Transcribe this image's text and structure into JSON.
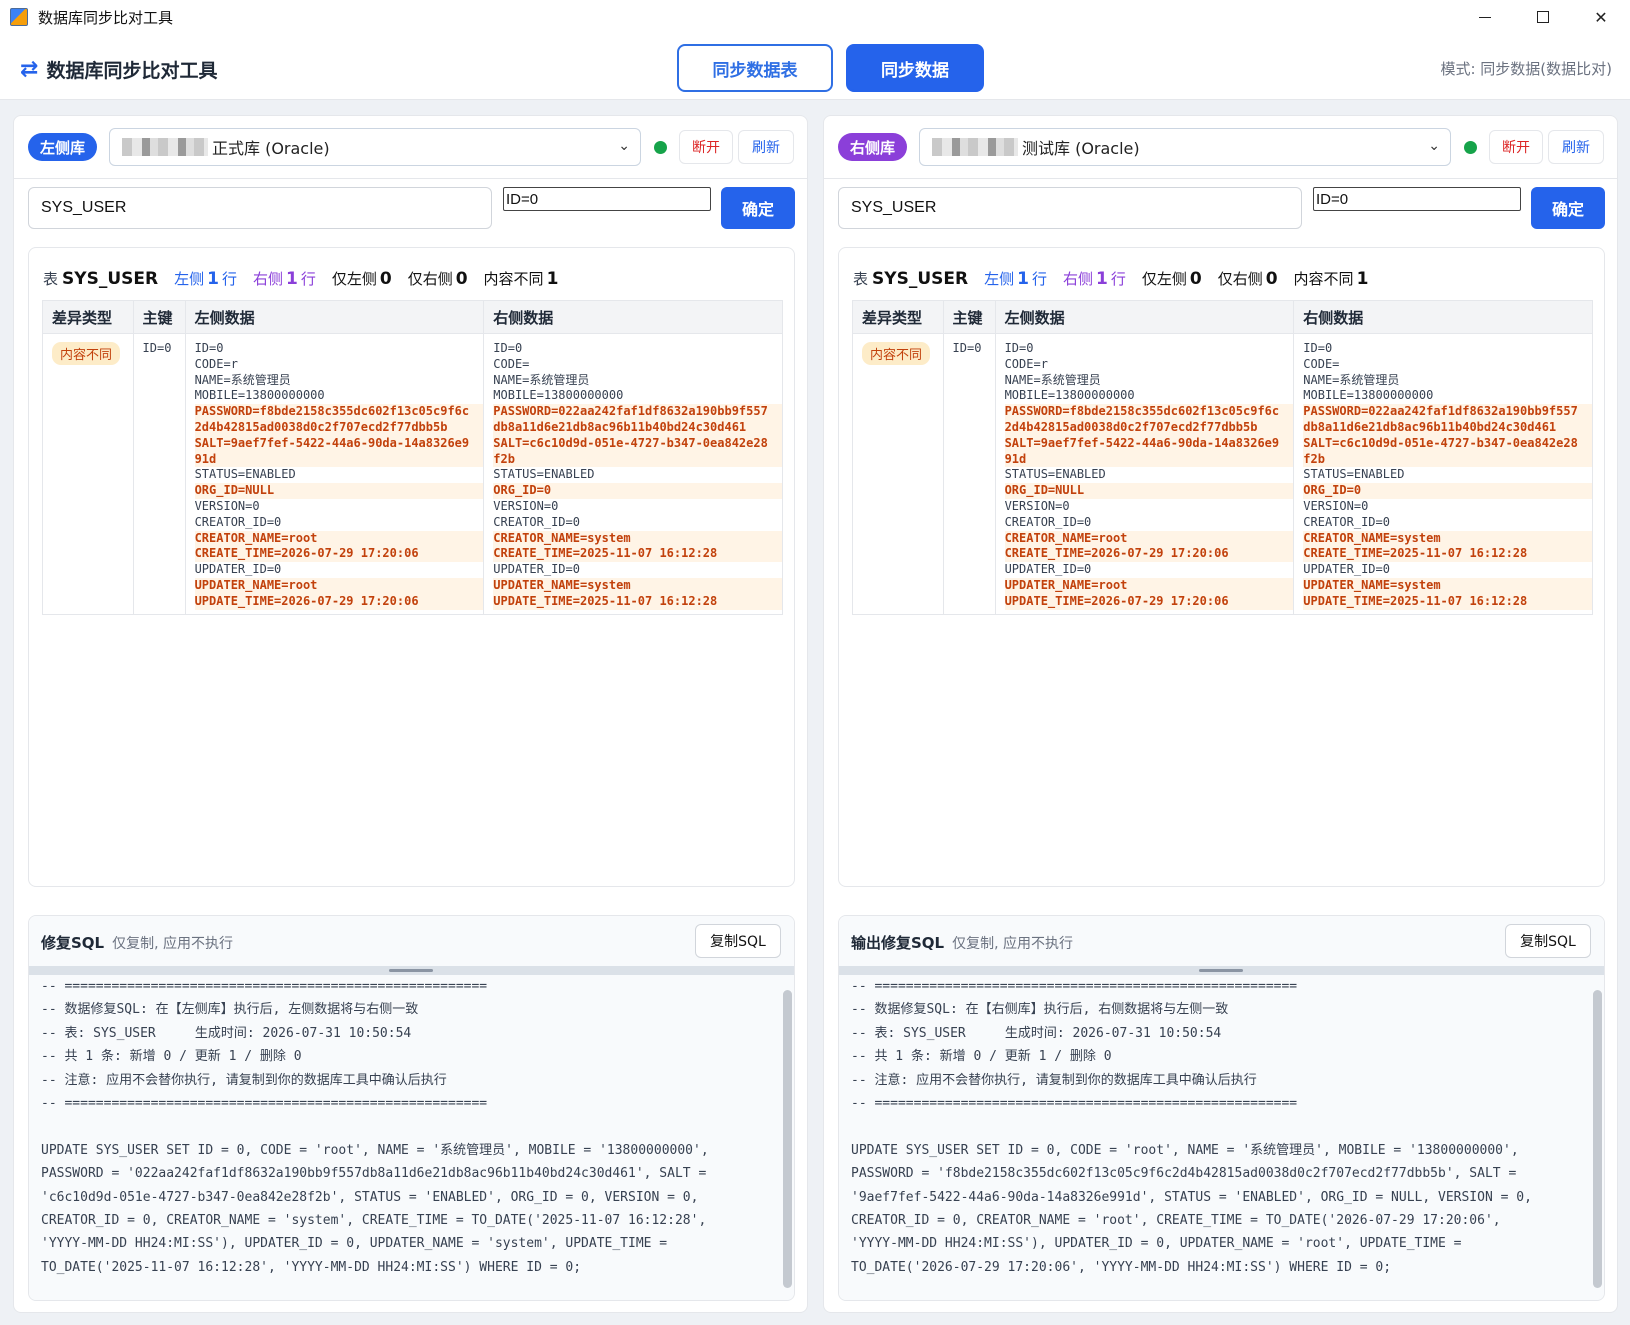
{
  "window": {
    "title": "数据库同步比对工具"
  },
  "header": {
    "brand_title": "数据库同步比对工具",
    "btn_sync_tables": "同步数据表",
    "btn_sync_data": "同步数据",
    "mode_text": "模式: 同步数据(数据比对)"
  },
  "panels": {
    "left": {
      "badge": "左侧库",
      "db_name": "正式库 (Oracle)",
      "disconnect": "断开",
      "refresh": "刷新",
      "table_value": "SYS_USER",
      "where_value": "ID=0",
      "confirm": "确定",
      "sql_title": "修复SQL",
      "sql_sub": "仅复制, 应用不执行",
      "copy": "复制SQL",
      "sql_lines": [
        "-- ======================================================",
        "-- 数据修复SQL: 在【左侧库】执行后, 左侧数据将与右侧一致",
        "-- 表: SYS_USER     生成时间: 2026-07-31 10:50:54",
        "-- 共 1 条: 新增 0 / 更新 1 / 删除 0",
        "-- 注意: 应用不会替你执行, 请复制到你的数据库工具中确认后执行",
        "-- ======================================================",
        "",
        "UPDATE SYS_USER SET ID = 0, CODE = 'root', NAME = '系统管理员', MOBILE = '13800000000',",
        "PASSWORD = '022aa242faf1df8632a190bb9f557db8a11d6e21db8ac96b11b40bd24c30d461', SALT =",
        "'c6c10d9d-051e-4727-b347-0ea842e28f2b', STATUS = 'ENABLED', ORG_ID = 0, VERSION = 0,",
        "CREATOR_ID = 0, CREATOR_NAME = 'system', CREATE_TIME = TO_DATE('2025-11-07 16:12:28',",
        "'YYYY-MM-DD HH24:MI:SS'), UPDATER_ID = 0, UPDATER_NAME = 'system', UPDATE_TIME =",
        "TO_DATE('2025-11-07 16:12:28', 'YYYY-MM-DD HH24:MI:SS') WHERE ID = 0;"
      ]
    },
    "right": {
      "badge": "右侧库",
      "db_name": "测试库 (Oracle)",
      "disconnect": "断开",
      "refresh": "刷新",
      "table_value": "SYS_USER",
      "where_value": "ID=0",
      "confirm": "确定",
      "sql_title": "输出修复SQL",
      "sql_sub": "仅复制, 应用不执行",
      "copy": "复制SQL",
      "sql_lines": [
        "-- ======================================================",
        "-- 数据修复SQL: 在【右侧库】执行后, 右侧数据将与左侧一致",
        "-- 表: SYS_USER     生成时间: 2026-07-31 10:50:54",
        "-- 共 1 条: 新增 0 / 更新 1 / 删除 0",
        "-- 注意: 应用不会替你执行, 请复制到你的数据库工具中确认后执行",
        "-- ======================================================",
        "",
        "UPDATE SYS_USER SET ID = 0, CODE = 'root', NAME = '系统管理员', MOBILE = '13800000000',",
        "PASSWORD = 'f8bde2158c355dc602f13c05c9f6c2d4b42815ad0038d0c2f707ecd2f77dbb5b', SALT =",
        "'9aef7fef-5422-44a6-90da-14a8326e991d', STATUS = 'ENABLED', ORG_ID = NULL, VERSION = 0,",
        "CREATOR_ID = 0, CREATOR_NAME = 'root', CREATE_TIME = TO_DATE('2026-07-29 17:20:06',",
        "'YYYY-MM-DD HH24:MI:SS'), UPDATER_ID = 0, UPDATER_NAME = 'root', UPDATE_TIME =",
        "TO_DATE('2026-07-29 17:20:06', 'YYYY-MM-DD HH24:MI:SS') WHERE ID = 0;"
      ]
    }
  },
  "summary": {
    "table_prefix": "表",
    "table_name": "SYS_USER",
    "left_label": "左侧",
    "left_count": "1",
    "right_label": "右侧",
    "right_count": "1",
    "row_unit": "行",
    "only_left_label": "仅左侧",
    "only_left_count": "0",
    "only_right_label": "仅右侧",
    "only_right_count": "0",
    "diff_label": "内容不同",
    "diff_count": "1"
  },
  "diff_table": {
    "headers": [
      "差异类型",
      "主键",
      "左侧数据",
      "右侧数据"
    ],
    "row": {
      "type": "内容不同",
      "key": "ID=0",
      "left": [
        {
          "t": "ID=0",
          "d": false
        },
        {
          "t": "CODE=r",
          "d": false
        },
        {
          "t": "NAME=系统管理员",
          "d": false
        },
        {
          "t": "MOBILE=13800000000",
          "d": false
        },
        {
          "t": "PASSWORD=f8bde2158c355dc602f13c05c9f6c2d4b42815ad0038d0c2f707ecd2f77dbb5b",
          "d": true
        },
        {
          "t": "SALT=9aef7fef-5422-44a6-90da-14a8326e991d",
          "d": true
        },
        {
          "t": "STATUS=ENABLED",
          "d": false
        },
        {
          "t": "ORG_ID=NULL",
          "d": true
        },
        {
          "t": "VERSION=0",
          "d": false
        },
        {
          "t": "CREATOR_ID=0",
          "d": false
        },
        {
          "t": "CREATOR_NAME=root",
          "d": true
        },
        {
          "t": "CREATE_TIME=2026-07-29 17:20:06",
          "d": true
        },
        {
          "t": "UPDATER_ID=0",
          "d": false
        },
        {
          "t": "UPDATER_NAME=root",
          "d": true
        },
        {
          "t": "UPDATE_TIME=2026-07-29 17:20:06",
          "d": true
        }
      ],
      "right": [
        {
          "t": "ID=0",
          "d": false
        },
        {
          "t": "CODE=",
          "d": false
        },
        {
          "t": "NAME=系统管理员",
          "d": false
        },
        {
          "t": "MOBILE=13800000000",
          "d": false
        },
        {
          "t": "PASSWORD=022aa242faf1df8632a190bb9f557db8a11d6e21db8ac96b11b40bd24c30d461",
          "d": true
        },
        {
          "t": "SALT=c6c10d9d-051e-4727-b347-0ea842e28f2b",
          "d": true
        },
        {
          "t": "STATUS=ENABLED",
          "d": false
        },
        {
          "t": "ORG_ID=0",
          "d": true
        },
        {
          "t": "VERSION=0",
          "d": false
        },
        {
          "t": "CREATOR_ID=0",
          "d": false
        },
        {
          "t": "CREATOR_NAME=system",
          "d": true
        },
        {
          "t": "CREATE_TIME=2025-11-07 16:12:28",
          "d": true
        },
        {
          "t": "UPDATER_ID=0",
          "d": false
        },
        {
          "t": "UPDATER_NAME=system",
          "d": true
        },
        {
          "t": "UPDATE_TIME=2025-11-07 16:12:28",
          "d": true
        }
      ]
    }
  },
  "colors": {
    "accent": "#2563eb",
    "right_badge": "#8b3fd9",
    "diff_text": "#c2410c",
    "connected": "#16a34a",
    "danger": "#dc2626"
  },
  "icons": {
    "brand": "swap-arrows-icon",
    "select": "chevron-down-icon",
    "status": "connected-dot-icon"
  }
}
